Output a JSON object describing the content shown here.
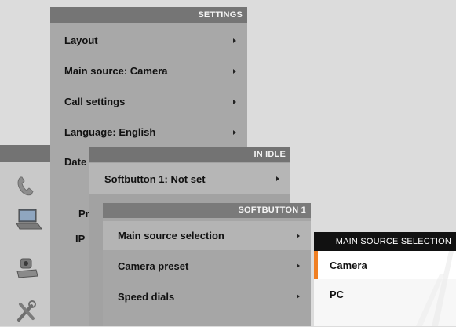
{
  "settings": {
    "title": "SETTINGS",
    "items": [
      {
        "label": "Layout"
      },
      {
        "label": "Main source: Camera"
      },
      {
        "label": "Call settings"
      },
      {
        "label": "Language: English"
      },
      {
        "label": "Date a"
      }
    ],
    "partial_items": [
      "Pr",
      "IP"
    ]
  },
  "in_idle": {
    "title": "IN IDLE",
    "items": [
      {
        "label": "Softbutton 1: Not set"
      }
    ]
  },
  "softbutton": {
    "title": "SOFTBUTTON 1",
    "items": [
      {
        "label": "Main source selection"
      },
      {
        "label": "Camera preset"
      },
      {
        "label": "Speed dials"
      }
    ]
  },
  "main_source_selection": {
    "title": "MAIN SOURCE SELECTION",
    "options": [
      {
        "label": "Camera",
        "selected": true
      },
      {
        "label": "PC",
        "selected": false
      }
    ]
  },
  "side_icons": [
    "phone-icon",
    "laptop-icon",
    "camera-icon",
    "tools-icon"
  ],
  "colors": {
    "accent": "#f07f22",
    "title_bar": "#757575",
    "panel": "#a8a8a8",
    "selection_bg": "#111111"
  }
}
